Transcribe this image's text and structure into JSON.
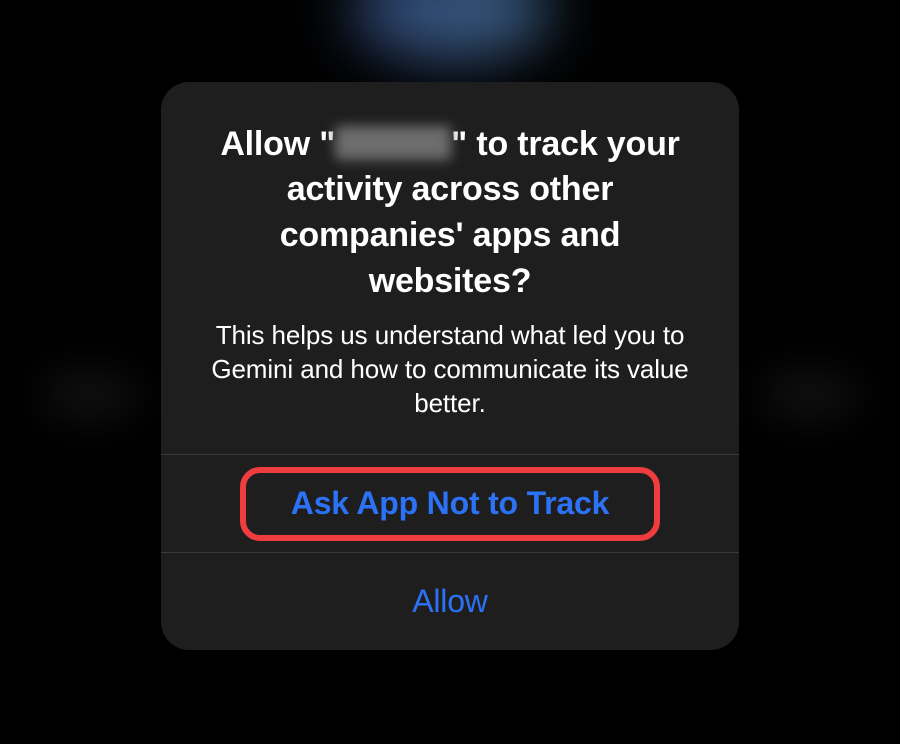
{
  "dialog": {
    "title_prefix": "Allow \"",
    "title_suffix": "\" to track your activity across other companies' apps and websites?",
    "app_name_redacted": true,
    "description": "This helps us understand what led you to Gemini and how to communicate its value better.",
    "buttons": {
      "deny": "Ask App Not to Track",
      "allow": "Allow"
    }
  },
  "annotation": {
    "highlighted_button": "deny"
  }
}
